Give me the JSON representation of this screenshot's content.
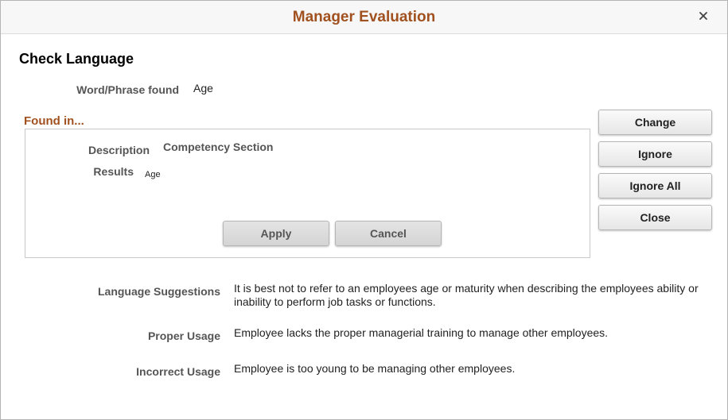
{
  "window": {
    "title": "Manager Evaluation",
    "close_glyph": "✕"
  },
  "page": {
    "heading": "Check Language"
  },
  "word_phrase": {
    "label": "Word/Phrase found",
    "value": "Age"
  },
  "found_in": {
    "heading": "Found in...",
    "description_label": "Description",
    "description_value": "Competency Section",
    "results_label": "Results",
    "results_value": "Age",
    "apply_label": "Apply",
    "cancel_label": "Cancel"
  },
  "side_buttons": {
    "change": "Change",
    "ignore": "Ignore",
    "ignore_all": "Ignore All",
    "close": "Close"
  },
  "suggestions": {
    "language_label": "Language Suggestions",
    "language_text": "It is best not to refer to an employees age or maturity when describing the employees ability or inability to perform job tasks or functions.",
    "proper_label": "Proper Usage",
    "proper_text": "Employee lacks the proper managerial training to manage other employees.",
    "incorrect_label": "Incorrect Usage",
    "incorrect_text": "Employee is too young to be managing other employees."
  },
  "colors": {
    "title": "#a0511f",
    "section_heading": "#a0511f"
  }
}
